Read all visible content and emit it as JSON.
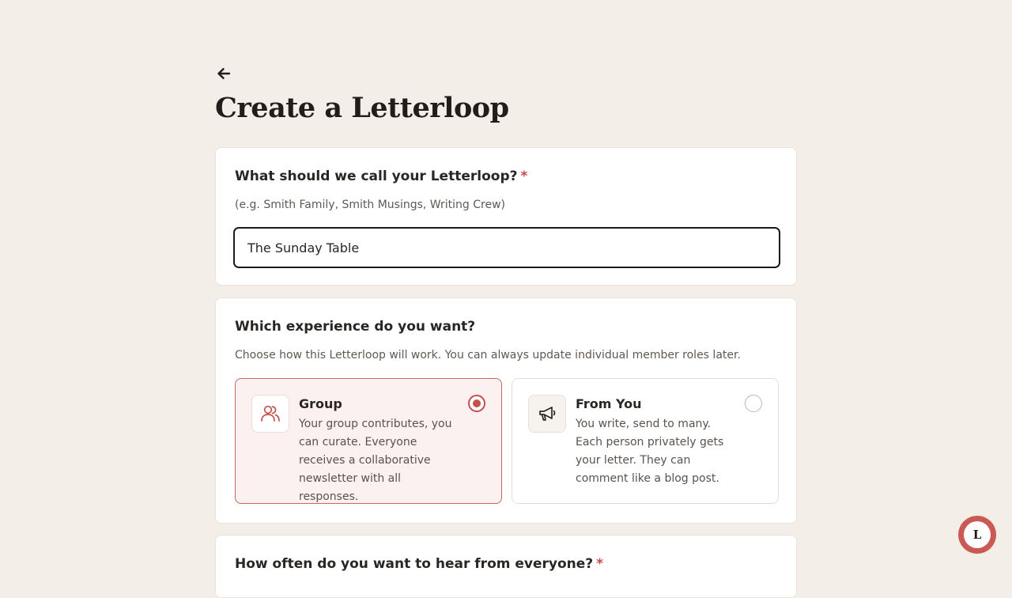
{
  "header": {
    "back_icon": "arrow-left-icon",
    "title": "Create a Letterloop"
  },
  "name_section": {
    "question": "What should we call your Letterloop?",
    "required_mark": "*",
    "hint": "(e.g. Smith Family, Smith Musings, Writing Crew)",
    "input_value": "The Sunday Table"
  },
  "experience_section": {
    "question": "Which experience do you want?",
    "description": "Choose how this Letterloop will work. You can always update individual member roles later.",
    "options": [
      {
        "title": "Group",
        "description": "Your group contributes, you can curate. Everyone receives a collaborative newsletter with all responses.",
        "icon": "users-icon",
        "selected": true
      },
      {
        "title": "From You",
        "description": "You write, send to many. Each person privately gets your letter. They can comment like a blog post.",
        "icon": "megaphone-icon",
        "selected": false
      }
    ]
  },
  "frequency_section": {
    "question": "How often do you want to hear from everyone?",
    "required_mark": "*"
  },
  "fab": {
    "label": "L"
  },
  "colors": {
    "background": "#f3eee8",
    "accent": "#c44f4b",
    "selected_bg": "#faf1f0"
  }
}
